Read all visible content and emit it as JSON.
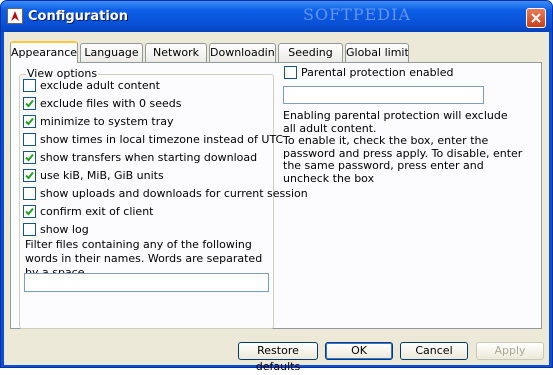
{
  "window": {
    "title": "Configuration",
    "watermark": "SOFTPEDIA"
  },
  "tabs": [
    {
      "label": "Appearance",
      "active": true
    },
    {
      "label": "Language"
    },
    {
      "label": "Network"
    },
    {
      "label": "Downloading"
    },
    {
      "label": "Seeding"
    },
    {
      "label": "Global limits"
    }
  ],
  "view_options": {
    "title": "View options",
    "items": [
      {
        "label": "exclude adult content",
        "checked": false
      },
      {
        "label": "exclude files with 0 seeds",
        "checked": true
      },
      {
        "label": "minimize to system tray",
        "checked": true
      },
      {
        "label": "show times in local timezone instead of UTC",
        "checked": false
      },
      {
        "label": "show transfers when starting download",
        "checked": true
      },
      {
        "label": "use kiB, MiB, GiB units",
        "checked": true
      },
      {
        "label": "show uploads and downloads for current session",
        "checked": false
      },
      {
        "label": "confirm exit of client",
        "checked": true
      },
      {
        "label": "show log",
        "checked": false
      }
    ],
    "filter_description": "Filter files containing any of the following words in their names. Words are separated by a space",
    "filter_value": ""
  },
  "parental": {
    "label": "Parental protection enabled",
    "checked": false,
    "password_value": "",
    "description": "Enabling parental protection will exclude all adult content.\nTo enable it, check the box, enter the password and press apply. To disable, enter the same password, press enter and uncheck the box"
  },
  "buttons": {
    "restore": "Restore defaults",
    "ok": "OK",
    "cancel": "Cancel",
    "apply": "Apply"
  }
}
